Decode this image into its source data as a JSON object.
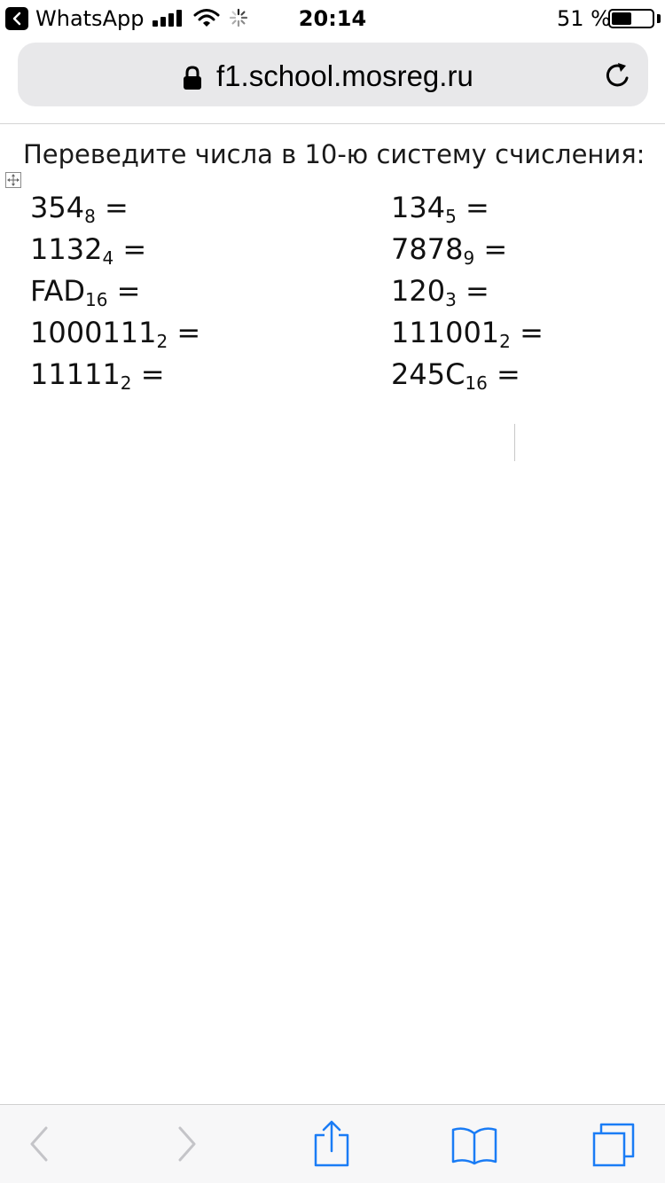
{
  "status_bar": {
    "back_app": "WhatsApp",
    "time": "20:14",
    "battery_text": "51 %",
    "battery_level": 0.51
  },
  "address_bar": {
    "url": "f1.school.mosreg.ru"
  },
  "page": {
    "instruction": "Переведите числа в 10-ю систему счисления:",
    "exercises": [
      [
        {
          "number": "354",
          "base": "8",
          "suffix": " ="
        },
        {
          "number": "134",
          "base": "5",
          "suffix": " ="
        }
      ],
      [
        {
          "number": "1132",
          "base": "4",
          "suffix": " ="
        },
        {
          "number": "7878",
          "base": "9",
          "suffix": " ="
        }
      ],
      [
        {
          "number": "FAD",
          "base": "16",
          "suffix": " ="
        },
        {
          "number": "120",
          "base": "3",
          "suffix": " ="
        }
      ],
      [
        {
          "number": "1000111",
          "base": "2",
          "suffix": " ="
        },
        {
          "number": "111001",
          "base": "2",
          "suffix": " ="
        }
      ],
      [
        {
          "number": "11111",
          "base": "2",
          "suffix": " ="
        },
        {
          "number": "245C",
          "base": "16",
          "suffix": " ="
        }
      ]
    ]
  },
  "toolbar": {
    "icons": [
      "back-arrow-icon",
      "forward-arrow-icon",
      "share-icon",
      "bookmarks-icon",
      "tabs-icon"
    ]
  },
  "colors": {
    "accent": "#1a7cf5",
    "disabled": "#c4c4c8"
  }
}
